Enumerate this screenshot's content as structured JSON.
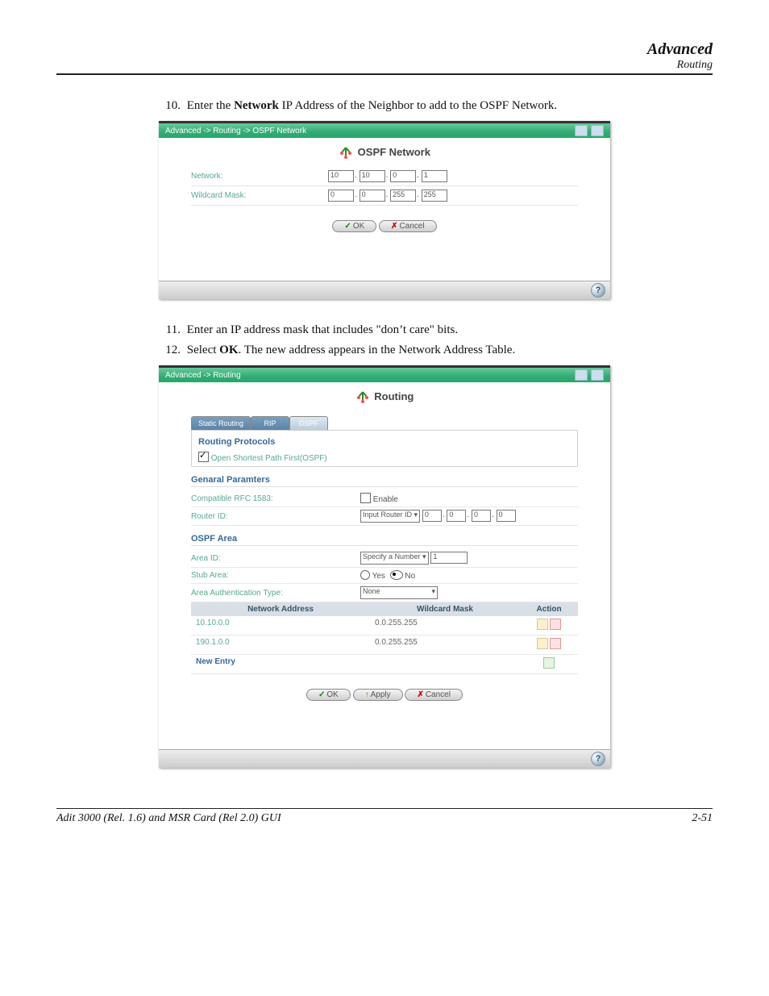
{
  "header": {
    "title": "Advanced",
    "subtitle": "Routing"
  },
  "steps": [
    {
      "n": "10.",
      "pre": "Enter the ",
      "bold": "Network",
      "post": " IP Address of the Neighbor to add to the OSPF Network."
    },
    {
      "n": "11.",
      "pre": "Enter an IP address mask that includes \"don’t care\" bits.",
      "bold": "",
      "post": ""
    },
    {
      "n": "12.",
      "pre": "Select ",
      "bold": "OK",
      "post": ". The new address appears in the Network Address Table."
    }
  ],
  "shot1": {
    "breadcrumb": "Advanced -> Routing -> OSPF Network",
    "title": "OSPF Network",
    "rows": {
      "network_label": "Network:",
      "network_ip": [
        "10",
        "10",
        "0",
        "1"
      ],
      "mask_label": "Wildcard Mask:",
      "mask_ip": [
        "0",
        "0",
        "255",
        "255"
      ]
    },
    "buttons": {
      "ok": "OK",
      "cancel": "Cancel"
    }
  },
  "shot2": {
    "breadcrumb": "Advanced -> Routing",
    "title": "Routing",
    "tabs": [
      "Static Routing",
      "RIP",
      "OSPF"
    ],
    "sec_protocols": "Routing Protocols",
    "protocols_cb_label": "Open Shortest Path First(OSPF)",
    "sec_general": "Genaral Paramters",
    "row_compat_label": "Compatible RFC 1583:",
    "row_compat_value": "Enable",
    "row_rid_label": "Router ID:",
    "row_rid_select": "Input Router ID",
    "row_rid_ip": [
      "0",
      "0",
      "0",
      "0"
    ],
    "sec_area": "OSPF Area",
    "row_area_label": "Area ID:",
    "row_area_select": "Specify a Number",
    "row_area_value": "1",
    "row_stub_label": "Stub Area:",
    "row_stub_yes": "Yes",
    "row_stub_no": "No",
    "row_auth_label": "Area Authentication Type:",
    "row_auth_value": "None",
    "table": {
      "h1": "Network Address",
      "h2": "Wildcard Mask",
      "h3": "Action",
      "rows": [
        {
          "addr": "10.10.0.0",
          "mask": "0.0.255.255"
        },
        {
          "addr": "190.1.0.0",
          "mask": "0.0.255.255"
        }
      ],
      "new_entry": "New Entry"
    },
    "buttons": {
      "ok": "OK",
      "apply": "Apply",
      "cancel": "Cancel"
    }
  },
  "footer": {
    "left": "Adit 3000 (Rel. 1.6) and MSR Card (Rel 2.0) GUI",
    "right": "2-51"
  }
}
